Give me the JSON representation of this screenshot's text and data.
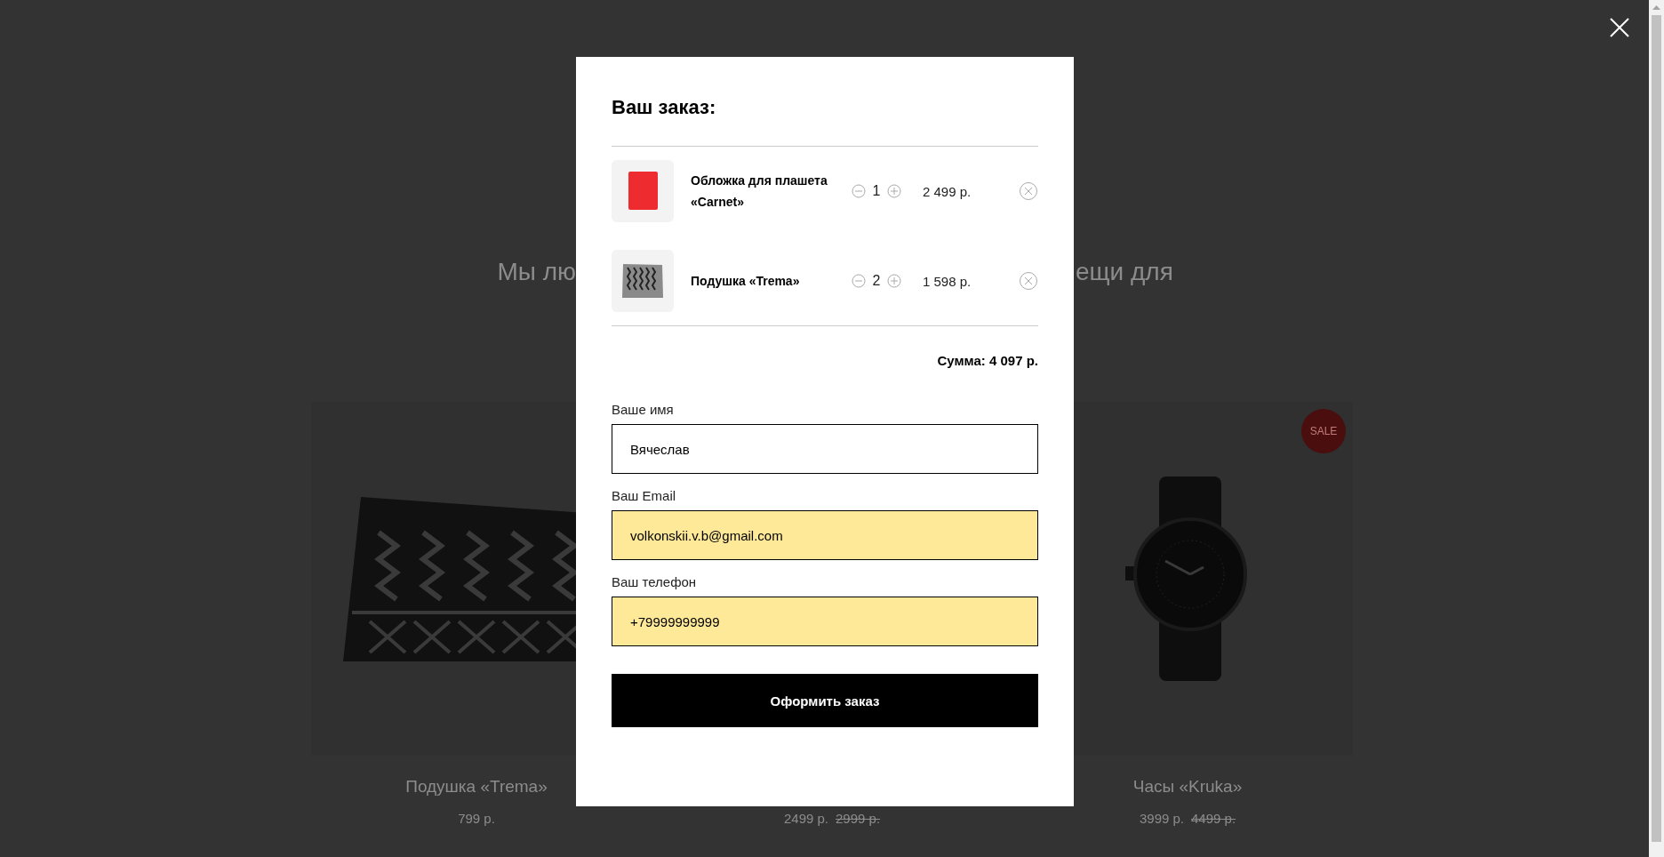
{
  "background": {
    "heading_left": "Мы лю",
    "heading_right": "ещи для",
    "products": [
      {
        "kind": "pillow",
        "title": "Подушка «Trema»",
        "price": "799 р."
      },
      {
        "price": "2499 р.",
        "old_price": "2999 р."
      },
      {
        "kind": "watch",
        "badge": "SALE",
        "title": "Часы «Kruka»",
        "price": "3999 р.",
        "old_price": "4499 р."
      }
    ]
  },
  "cart": {
    "title": "Ваш заказ:",
    "items": [
      {
        "kind": "cover",
        "name": "Обложка для плашета «Carnet»",
        "quantity": "1",
        "price": "2 499 р."
      },
      {
        "kind": "pillow",
        "name": "Подушка «Trema»",
        "quantity": "2",
        "price": "1 598 р."
      }
    ],
    "total": "Сумма: 4 097 р.",
    "fields": [
      {
        "label": "Ваше имя",
        "value": "Вячеслав",
        "autofilled": false
      },
      {
        "label": "Ваш Email",
        "value": "volkonskii.v.b@gmail.com",
        "autofilled": true
      },
      {
        "label": "Ваш телефон",
        "value": "+79999999999",
        "autofilled": true
      }
    ],
    "submit": "Оформить заказ"
  }
}
